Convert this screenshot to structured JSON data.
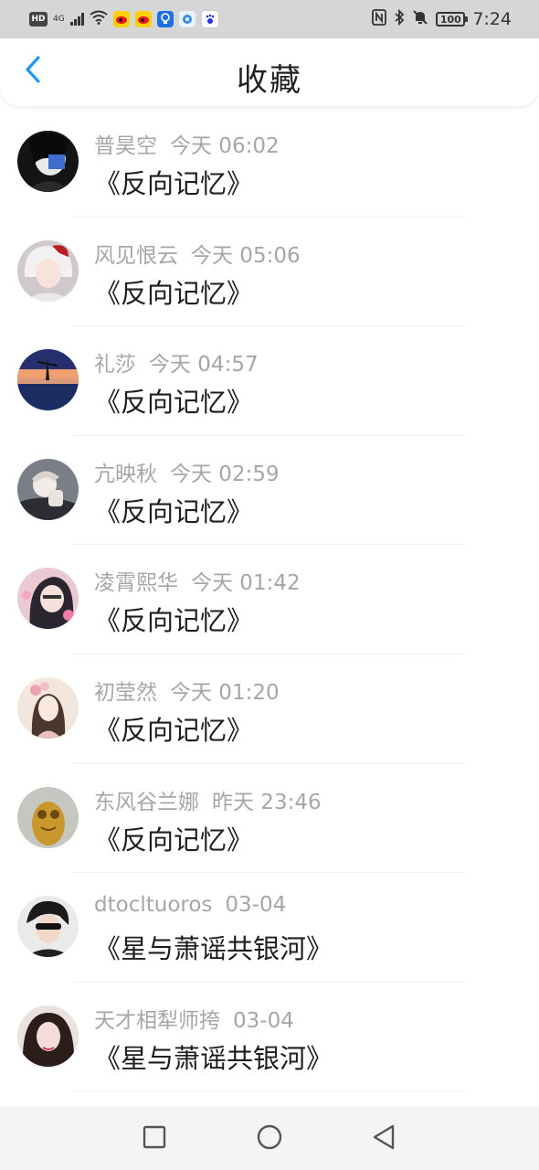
{
  "status_bar": {
    "hd_label": "HD",
    "network_label": "4G",
    "time": "7:24",
    "battery": "100",
    "icons": [
      "hd-icon",
      "signal-icon",
      "wifi-icon",
      "weibo-icon",
      "weibo-icon",
      "app-icon",
      "app-icon",
      "baidu-icon",
      "nfc-icon",
      "bluetooth-icon",
      "mute-icon",
      "battery-icon"
    ]
  },
  "header": {
    "title": "收藏",
    "back_icon": "chevron-left-icon",
    "accent_color": "#2196f3"
  },
  "favorites": [
    {
      "user": "普昊空",
      "time": "今天 06:02",
      "title": "《反向记忆》"
    },
    {
      "user": "风见恨云",
      "time": "今天 05:06",
      "title": "《反向记忆》"
    },
    {
      "user": "礼莎",
      "time": "今天 04:57",
      "title": "《反向记忆》"
    },
    {
      "user": "亢映秋",
      "time": "今天 02:59",
      "title": "《反向记忆》"
    },
    {
      "user": "凌霄熙华",
      "time": "今天 01:42",
      "title": "《反向记忆》"
    },
    {
      "user": "初莹然",
      "time": "今天 01:20",
      "title": "《反向记忆》"
    },
    {
      "user": "东风谷兰娜",
      "time": "昨天 23:46",
      "title": "《反向记忆》"
    },
    {
      "user": "dtocltuoros",
      "time": "03-04",
      "title": "《星与萧谣共银河》"
    },
    {
      "user": "天才相犁师挎",
      "time": "03-04",
      "title": "《星与萧谣共银河》"
    }
  ],
  "nav": {
    "icons": [
      "recents-square-icon",
      "home-circle-icon",
      "back-triangle-icon"
    ]
  }
}
